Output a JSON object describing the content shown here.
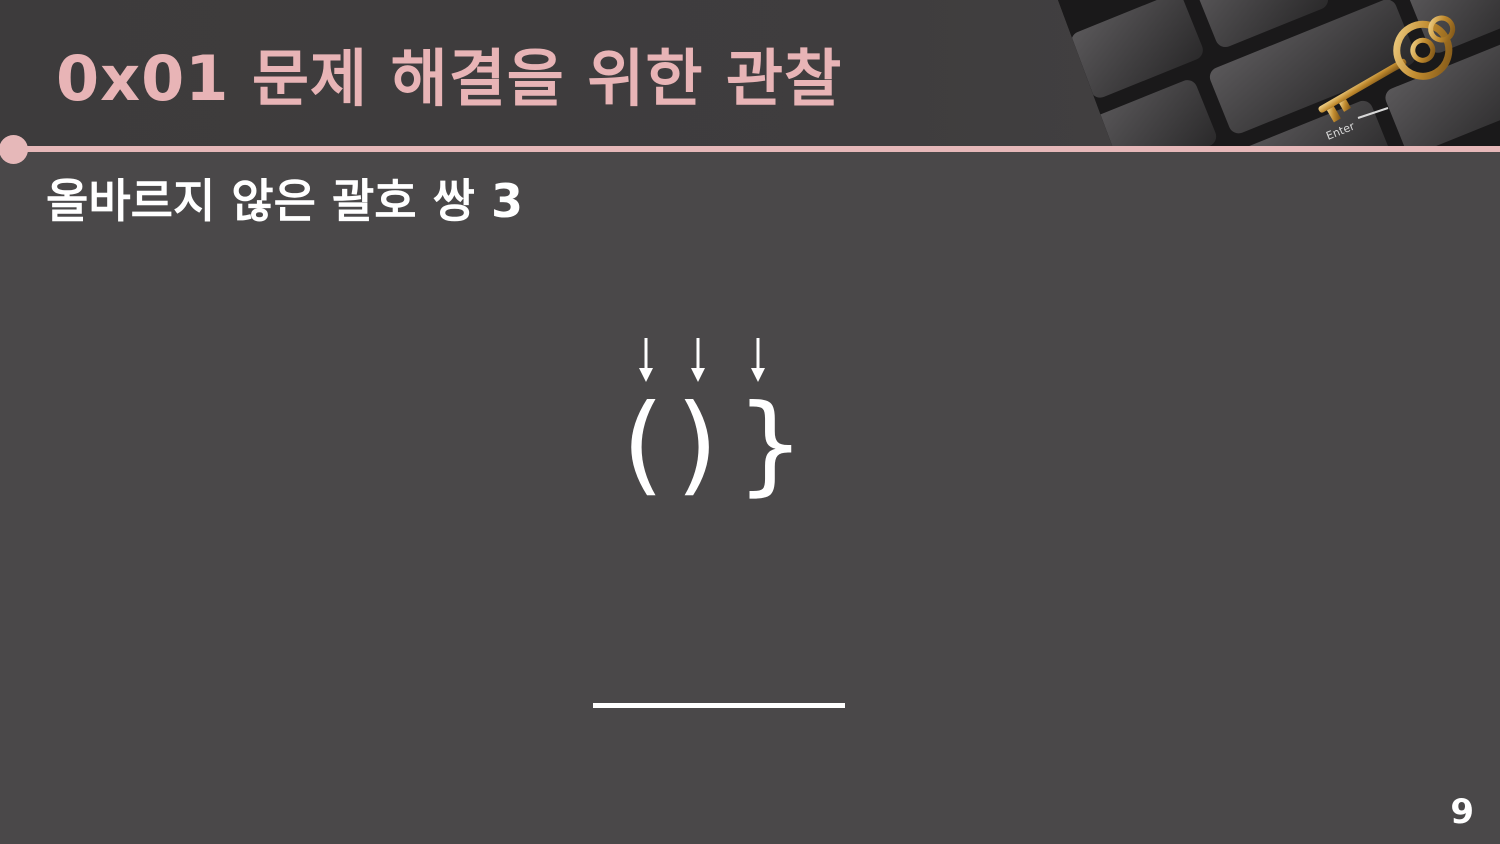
{
  "slide": {
    "title": "0x01  문제 해결을 위한 관찰",
    "subtitle": "올바르지 않은 괄호 쌍 3",
    "brackets": [
      "(",
      ")",
      "}"
    ],
    "answer_blank": "",
    "page_number": "9",
    "photo_key_label": "Enter"
  },
  "colors": {
    "background": "#4a4849",
    "header": "#3d3b3c",
    "accent": "#e6b8b9",
    "title": "#e8b4b6",
    "text": "#ffffff"
  }
}
